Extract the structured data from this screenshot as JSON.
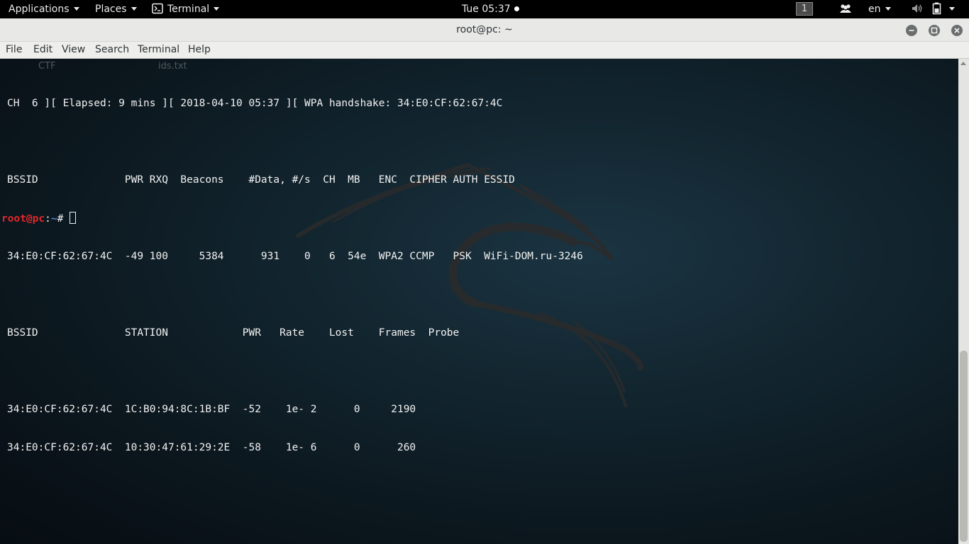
{
  "topbar": {
    "applications_label": "Applications",
    "places_label": "Places",
    "terminal_label": "Terminal",
    "clock": "Tue 05:37",
    "workspace": "1",
    "language": "en",
    "icons": [
      "terminal-app-icon",
      "people-icon",
      "volume-icon",
      "battery-icon",
      "power-caret-icon"
    ]
  },
  "window": {
    "title": "root@pc: ~",
    "buttons": [
      "minimize",
      "maximize",
      "close"
    ]
  },
  "menu": {
    "file": "File",
    "edit": "Edit",
    "view": "View",
    "search": "Search",
    "terminal": "Terminal",
    "help": "Help"
  },
  "desktop_ghost": {
    "item1": "CTF",
    "item2": "ids.txt"
  },
  "terminal": {
    "lines": [
      "CH  6 ][ Elapsed: 9 mins ][ 2018-04-10 05:37 ][ WPA handshake: 34:E0:CF:62:67:4C",
      "",
      "BSSID              PWR RXQ  Beacons    #Data, #/s  CH  MB   ENC  CIPHER AUTH ESSID",
      "",
      "34:E0:CF:62:67:4C  -49 100     5384      931    0   6  54e  WPA2 CCMP   PSK  WiFi-DOM.ru-3246",
      "",
      "BSSID              STATION            PWR   Rate    Lost    Frames  Probe",
      "",
      "34:E0:CF:62:67:4C  1C:B0:94:8C:1B:BF  -52    1e- 2      0     2190",
      "34:E0:CF:62:67:4C  10:30:47:61:29:2E  -58    1e- 6      0      260"
    ],
    "prompt_user": "root@pc",
    "prompt_sep": ":",
    "prompt_path": "~",
    "prompt_symbol": "# "
  },
  "colors": {
    "prompt_user": "#e0282b",
    "prompt_path": "#5486c7",
    "terminal_text": "#f2f2f2",
    "terminal_bg": "#0b161d"
  }
}
